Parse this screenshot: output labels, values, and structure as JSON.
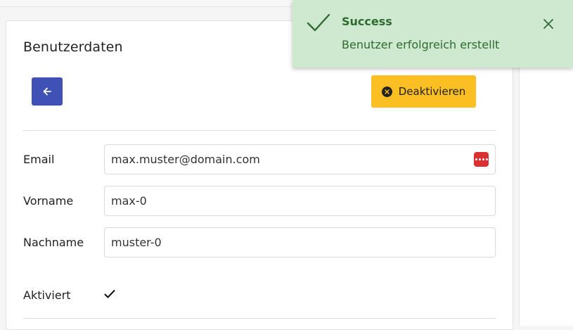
{
  "card": {
    "title": "Benutzerdaten",
    "deactivate_label": "Deaktivieren"
  },
  "form": {
    "email_label": "Email",
    "email_value": "max.muster@domain.com",
    "firstname_label": "Vorname",
    "firstname_value": "max-0",
    "lastname_label": "Nachname",
    "lastname_value": "muster-0",
    "active_label": "Aktiviert",
    "active_checked": true
  },
  "toast": {
    "title": "Success",
    "message": "Benutzer erfolgreich erstellt"
  },
  "icons": {
    "back": "arrow-left-icon",
    "deactivate": "x-circle-icon",
    "password_manager": "password-manager-icon",
    "success": "check-icon",
    "close": "close-icon",
    "active": "check-icon"
  },
  "colors": {
    "primary": "#3f51b5",
    "warning": "#fbbf24",
    "success_bg": "#cfe9d0",
    "success_text": "#2e6b30"
  }
}
